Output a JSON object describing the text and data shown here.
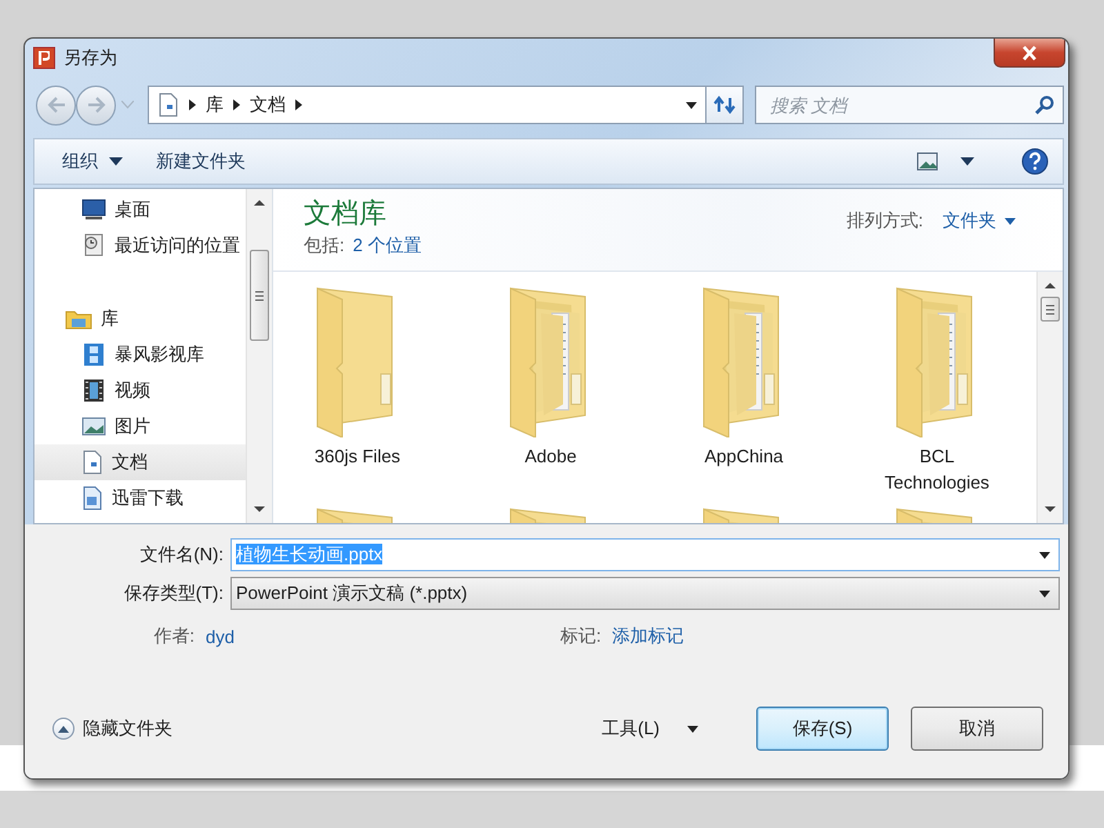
{
  "window": {
    "title": "另存为"
  },
  "navigation": {
    "path": [
      "库",
      "文档"
    ],
    "search": {
      "placeholder": "搜索 文档"
    }
  },
  "toolbar": {
    "organize": "组织",
    "new_folder": "新建文件夹"
  },
  "sidebar": {
    "favorites": [
      {
        "label": "桌面",
        "selected": false
      },
      {
        "label": "最近访问的位置",
        "selected": false
      }
    ],
    "library": {
      "label": "库",
      "selected": false,
      "children": [
        {
          "label": "暴风影视库",
          "selected": false
        },
        {
          "label": "视频",
          "selected": false
        },
        {
          "label": "图片",
          "selected": false
        },
        {
          "label": "文档",
          "selected": true
        },
        {
          "label": "迅雷下载",
          "selected": false
        }
      ]
    }
  },
  "content": {
    "title": "文档库",
    "includes_label": "包括:",
    "includes_link": "2 个位置",
    "arrange_label": "排列方式:",
    "arrange_value": "文件夹",
    "folders": [
      {
        "label": "360js Files",
        "kind": "empty"
      },
      {
        "label": "Adobe",
        "kind": "documents"
      },
      {
        "label": "AppChina",
        "kind": "documents"
      },
      {
        "label": "BCL Technologies",
        "kind": "documents"
      },
      {
        "kind": "documents"
      },
      {
        "kind": "documents"
      },
      {
        "kind": "documents"
      },
      {
        "kind": "documents"
      }
    ]
  },
  "form": {
    "file_name": {
      "label": "文件名(N):",
      "value": "植物生长动画.pptx",
      "selected": true
    },
    "file_type": {
      "label": "保存类型(T):",
      "value": "PowerPoint 演示文稿 (*.pptx)"
    },
    "author": {
      "label": "作者:",
      "value": "dyd"
    },
    "tags": {
      "label": "标记:",
      "value": "添加标记"
    }
  },
  "footer": {
    "hide_folders": "隐藏文件夹",
    "tools": "工具(L)",
    "save": "保存(S)",
    "cancel": "取消"
  }
}
